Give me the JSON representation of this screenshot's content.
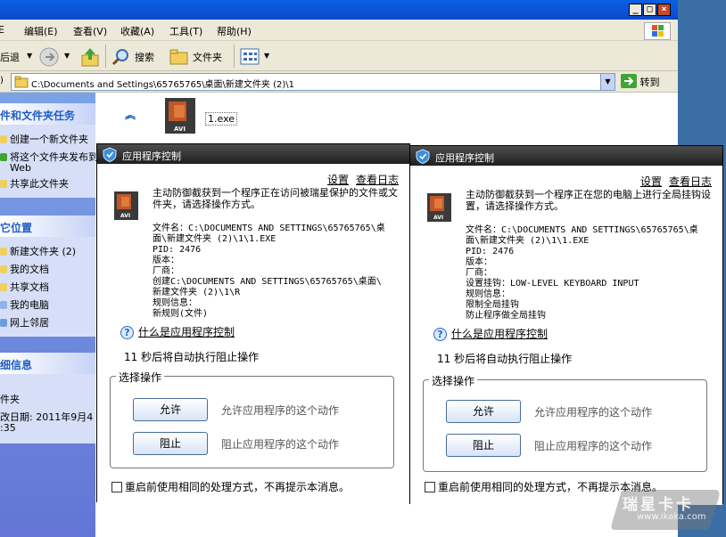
{
  "explorer": {
    "menu": [
      "编辑(E)",
      "查看(V)",
      "收藏(A)",
      "工具(T)",
      "帮助(H)"
    ],
    "toolbar": {
      "back": "后退",
      "search": "搜索",
      "folders": "文件夹"
    },
    "address": {
      "path": "C:\\Documents and Settings\\65765765\\桌面\\新建文件夹 (2)\\1",
      "go": "转到"
    },
    "tasks": {
      "title": "件和文件夹任务",
      "items": [
        "创建一个新文件夹",
        "将这个文件夹发布到",
        "Web",
        "共享此文件夹"
      ]
    },
    "places": {
      "title": "它位置",
      "items": [
        "新建文件夹 (2)",
        "我的文档",
        "共享文档",
        "我的电脑",
        "网上邻居"
      ]
    },
    "details": {
      "title": "细信息",
      "lines": [
        "件夹",
        "改日期: 2011年9月4",
        ":35"
      ]
    },
    "file": {
      "name": "1.exe"
    }
  },
  "dialogs": [
    {
      "title": "应用程序控制",
      "settings": "设置",
      "log": "查看日志",
      "message": "主动防御截获到一个程序正在访问被瑞星保护的文件或文件夹，请选择操作方式。",
      "details": [
        "文件名：C:\\DOCUMENTS AND SETTINGS\\65765765\\桌",
        "面\\新建文件夹 (2)\\1\\1.EXE",
        "PID: 2476",
        "版本：",
        "厂商：",
        "创建C:\\DOCUMENTS AND SETTINGS\\65765765\\桌面\\",
        "新建文件夹 (2)\\1\\R",
        "规则信息：",
        "新规则(文件)"
      ],
      "whatis": "什么是应用程序控制",
      "countdown": "11 秒后将自动执行阻止操作",
      "group": "选择操作",
      "allow": {
        "label": "允许",
        "desc": "允许应用程序的这个动作"
      },
      "block": {
        "label": "阻止",
        "desc": "阻止应用程序的这个动作"
      },
      "remember": "重启前使用相同的处理方式，不再提示本消息。"
    },
    {
      "title": "应用程序控制",
      "settings": "设置",
      "log": "查看日志",
      "message": "主动防御截获到一个程序正在您的电脑上进行全局挂钩设置，请选择操作方式。",
      "details": [
        "文件名：C:\\DOCUMENTS AND SETTINGS\\65765765\\桌",
        "面\\新建文件夹 (2)\\1\\1.EXE",
        "PID: 2476",
        "版本：",
        "厂商：",
        "设置挂钩：LOW-LEVEL KEYBOARD INPUT",
        "规则信息：",
        "限制全局挂钩",
        "防止程序做全局挂钩"
      ],
      "whatis": "什么是应用程序控制",
      "countdown": "11 秒后将自动执行阻止操作",
      "group": "选择操作",
      "allow": {
        "label": "允许",
        "desc": "允许应用程序的这个动作"
      },
      "block": {
        "label": "阻止",
        "desc": "阻止应用程序的这个动作"
      },
      "remember": "重启前使用相同的处理方式，不再提示本消息。"
    }
  ],
  "watermark": {
    "brand": "瑞星卡卡",
    "url": "www.ikaka.com"
  }
}
